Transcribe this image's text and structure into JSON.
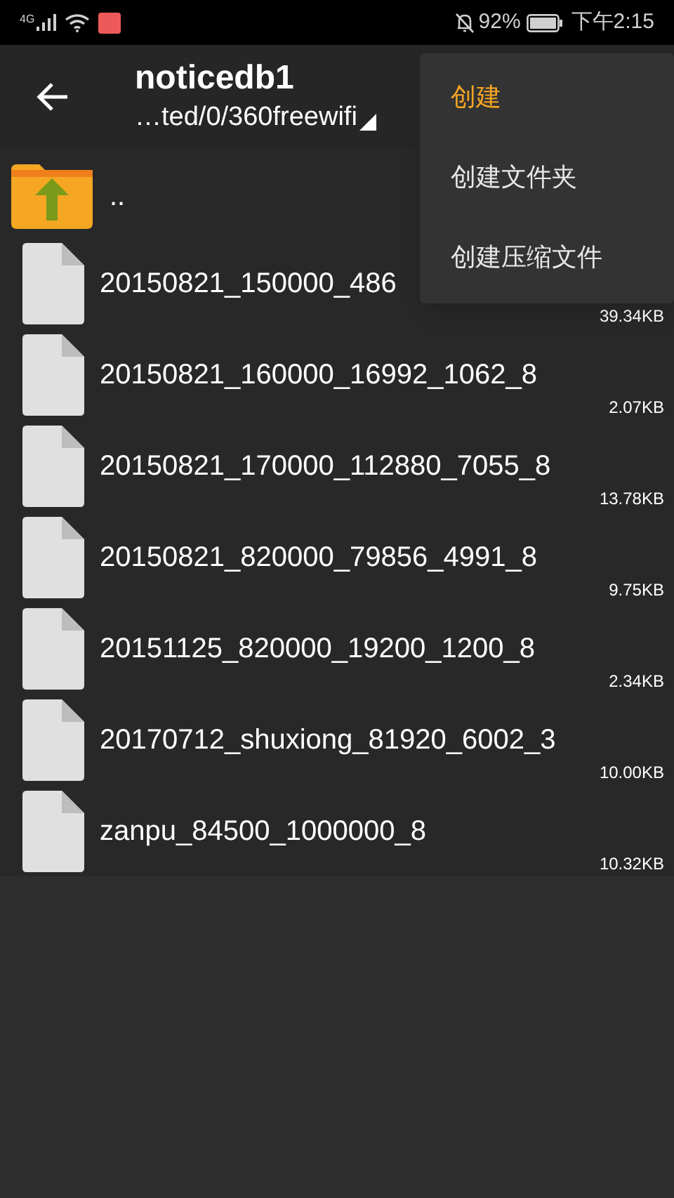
{
  "status_bar": {
    "network": "4G",
    "battery_percent": "92%",
    "time": "下午2:15"
  },
  "header": {
    "title": "noticedb1",
    "path": "…ted/0/360freewifi"
  },
  "files": [
    {
      "kind": "parent",
      "name": ".."
    },
    {
      "kind": "file",
      "name": "20150821_150000_486",
      "size": "39.34KB"
    },
    {
      "kind": "file",
      "name": "20150821_160000_16992_1062_8",
      "size": "2.07KB"
    },
    {
      "kind": "file",
      "name": "20150821_170000_112880_7055_8",
      "size": "13.78KB"
    },
    {
      "kind": "file",
      "name": "20150821_820000_79856_4991_8",
      "size": "9.75KB"
    },
    {
      "kind": "file",
      "name": "20151125_820000_19200_1200_8",
      "size": "2.34KB"
    },
    {
      "kind": "file",
      "name": "20170712_shuxiong_81920_6002_3",
      "size": "10.00KB"
    },
    {
      "kind": "file",
      "name": "zanpu_84500_1000000_8",
      "size": "10.32KB"
    }
  ],
  "menu": {
    "items": [
      {
        "label": "创建",
        "selected": true
      },
      {
        "label": "创建文件夹",
        "selected": false
      },
      {
        "label": "创建压缩文件",
        "selected": false
      }
    ]
  }
}
